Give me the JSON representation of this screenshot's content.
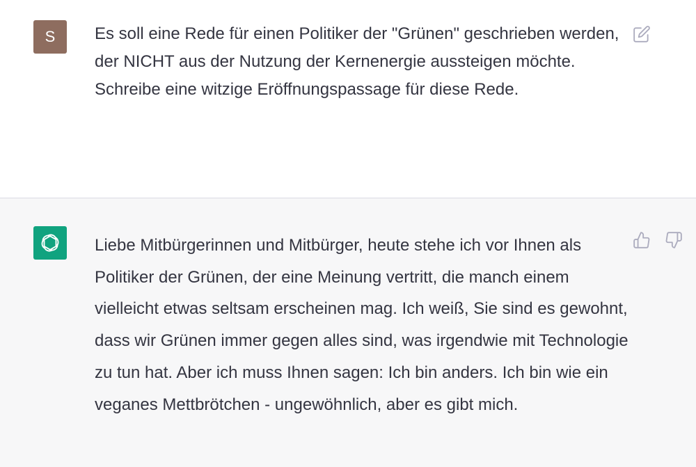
{
  "user_message": {
    "avatar_letter": "S",
    "avatar_color": "#8e6d5f",
    "text": "Es soll eine Rede für einen Politiker der \"Grünen\" geschrieben werden, der NICHT aus der Nutzung der Kernenergie aussteigen möchte. Schreibe eine witzige Eröffnungspassage für diese Rede.",
    "edit_icon": "edit-icon"
  },
  "assistant_message": {
    "avatar_icon": "openai-logo-icon",
    "avatar_color": "#10a37f",
    "text": "Liebe Mitbürgerinnen und Mitbürger, heute stehe ich vor Ihnen als Politiker der Grünen, der eine Meinung vertritt, die manch einem vielleicht etwas seltsam erscheinen mag. Ich weiß, Sie sind es gewohnt, dass wir Grünen immer gegen alles sind, was irgendwie mit Technologie zu tun hat. Aber ich muss Ihnen sagen: Ich bin anders. Ich bin wie ein veganes Mettbrötchen - ungewöhnlich, aber es gibt mich.",
    "feedback_icons": [
      "thumbs-up-icon",
      "thumbs-down-icon"
    ]
  }
}
